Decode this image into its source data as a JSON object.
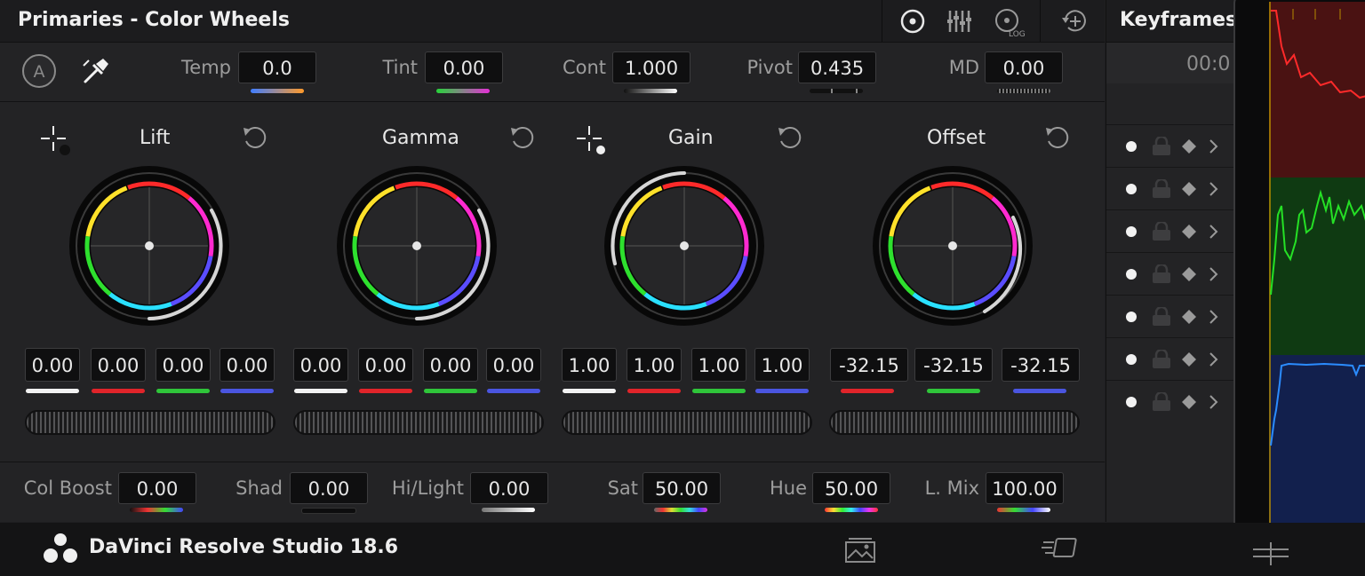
{
  "primaries": {
    "title": "Primaries - Color Wheels",
    "header_icons": [
      "wheels-icon",
      "bars-icon",
      "log-icon",
      "add-node-icon"
    ],
    "log_label": "LOG"
  },
  "controls": {
    "auto_badge": "A",
    "temp": {
      "label": "Temp",
      "value": "0.0"
    },
    "tint": {
      "label": "Tint",
      "value": "0.00"
    },
    "cont": {
      "label": "Cont",
      "value": "1.000"
    },
    "pivot": {
      "label": "Pivot",
      "value": "0.435"
    },
    "md": {
      "label": "MD",
      "value": "0.00"
    }
  },
  "wheels": [
    {
      "name": "Lift",
      "values": [
        "0.00",
        "0.00",
        "0.00",
        "0.00"
      ]
    },
    {
      "name": "Gamma",
      "values": [
        "0.00",
        "0.00",
        "0.00",
        "0.00"
      ]
    },
    {
      "name": "Gain",
      "values": [
        "1.00",
        "1.00",
        "1.00",
        "1.00"
      ]
    },
    {
      "name": "Offset",
      "values": [
        "-32.15",
        "-32.15",
        "-32.15"
      ]
    }
  ],
  "bottom": {
    "col_boost": {
      "label": "Col Boost",
      "value": "0.00"
    },
    "shad": {
      "label": "Shad",
      "value": "0.00"
    },
    "hilight": {
      "label": "Hi/Light",
      "value": "0.00"
    },
    "sat": {
      "label": "Sat",
      "value": "50.00"
    },
    "hue": {
      "label": "Hue",
      "value": "50.00"
    },
    "lmix": {
      "label": "L. Mix",
      "value": "100.00"
    }
  },
  "keyframes": {
    "title": "Keyframes",
    "timecode": "00:0",
    "row_count": 7
  },
  "footer": {
    "app_name": "DaVinci Resolve Studio 18.6"
  },
  "colors": {
    "red": "#e0242a",
    "green": "#2fc53a",
    "blue": "#4a55e0",
    "white": "#f2f2f2",
    "scope_red": "#ff2a2a",
    "scope_green": "#25e025",
    "scope_blue": "#2b8cff"
  }
}
